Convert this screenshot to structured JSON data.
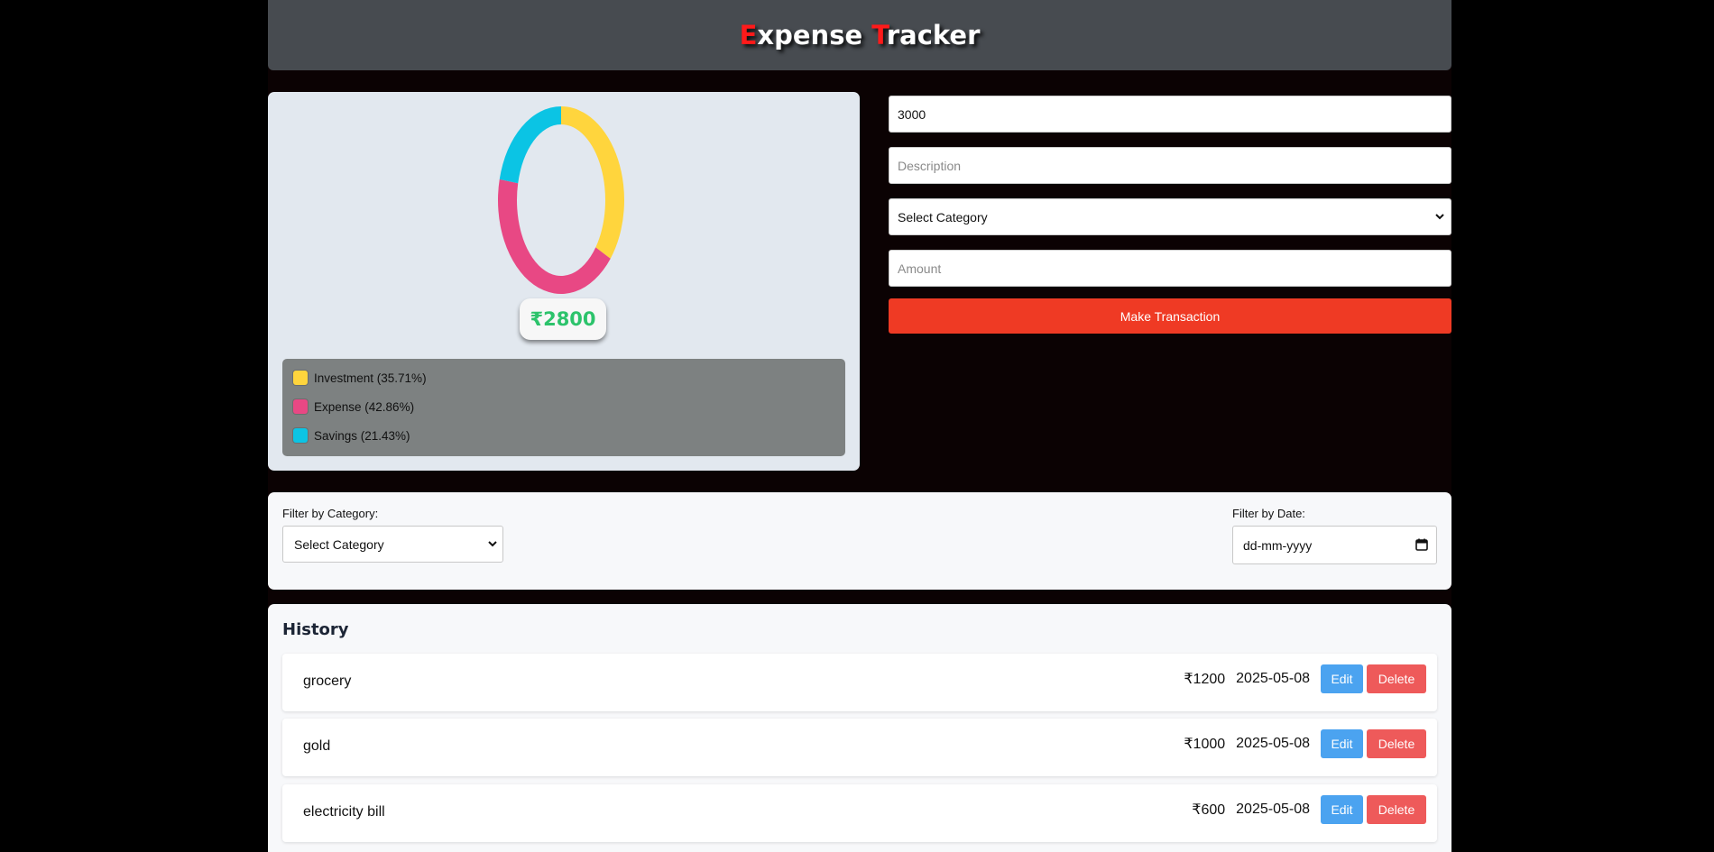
{
  "header": {
    "title_e_cap": "E",
    "title_e_rest": "xpense ",
    "title_t_cap": "T",
    "title_t_rest": "racker"
  },
  "chart": {
    "total": "₹2800",
    "legend": [
      {
        "label": "Investment (35.71%)",
        "color": "#ffd53d"
      },
      {
        "label": "Expense (42.86%)",
        "color": "#e84884"
      },
      {
        "label": "Savings (21.43%)",
        "color": "#0bc4e4"
      }
    ]
  },
  "chart_data": {
    "type": "pie",
    "donut": true,
    "categories": [
      "Investment",
      "Expense",
      "Savings"
    ],
    "values": [
      1000,
      1200,
      600
    ],
    "percentages": [
      35.71,
      42.86,
      21.43
    ],
    "colors": [
      "#ffd53d",
      "#e84884",
      "#0bc4e4"
    ],
    "center_label": "₹2800",
    "legend_position": "bottom"
  },
  "form": {
    "description_value": "3000",
    "description_placeholder": "Description",
    "category_select": "Select Category",
    "amount_placeholder": "Amount",
    "submit_label": "Make Transaction"
  },
  "filters": {
    "category_label": "Filter by Category:",
    "category_select": "Select Category",
    "date_label": "Filter by Date:",
    "date_placeholder": "dd-mm-yyyy"
  },
  "history": {
    "title": "History",
    "edit_label": "Edit",
    "delete_label": "Delete",
    "transactions": [
      {
        "description": "grocery",
        "amount": "₹1200",
        "date": "2025-05-08"
      },
      {
        "description": "gold",
        "amount": "₹1000",
        "date": "2025-05-08"
      },
      {
        "description": "electricity bill",
        "amount": "₹600",
        "date": "2025-05-08"
      }
    ]
  }
}
